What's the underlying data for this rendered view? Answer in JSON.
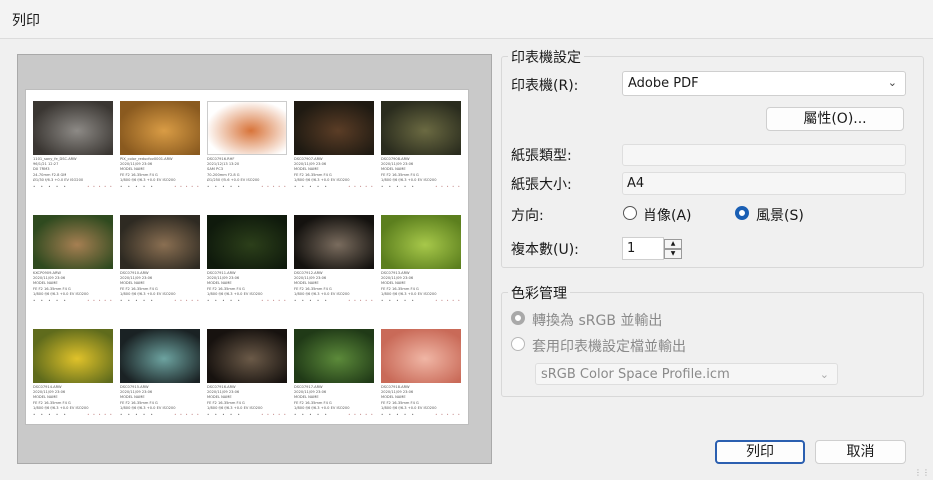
{
  "window": {
    "title": "列印"
  },
  "printer_settings": {
    "group_title": "印表機設定",
    "printer_label": "印表機(R):",
    "printer_value": "Adobe PDF",
    "properties_button": "屬性(O)...",
    "paper_type_label": "紙張類型:",
    "paper_type_value": "",
    "paper_size_label": "紙張大小:",
    "paper_size_value": "A4",
    "orientation_label": "方向:",
    "portrait_label": "肖像(A)",
    "landscape_label": "風景(S)",
    "orientation_selected": "landscape",
    "copies_label": "複本數(U):",
    "copies_value": "1"
  },
  "color_management": {
    "group_title": "色彩管理",
    "convert_srgb_label": "轉換為 sRGB 並輸出",
    "use_printer_profile_label": "套用印表機設定檔並輸出",
    "profile_value": "sRGB Color Space Profile.icm"
  },
  "buttons": {
    "print": "列印",
    "cancel": "取消"
  },
  "thumbnails": [
    {
      "c1": "#3a3632",
      "c2": "#8d8a86",
      "meta": [
        "1101_sony_fe_DSC.ARW",
        "96/1/21 12:27",
        "DX 7RM3",
        "24-70mm F2.8 GM",
        "Ø1/30 f/6.3 +0.0 EV ISO200"
      ]
    },
    {
      "c1": "#8a5a1f",
      "c2": "#d99c45",
      "meta": [
        "PIX_color_reducfov0001.ARW",
        "2020/11/09 23:06",
        "MODEL NAME",
        "FE F2 16-35mm F4 G",
        "1/800 f/6 f/6.3 +0.0 EV ISO200"
      ]
    },
    {
      "c1": "#ffffff",
      "c2": "#d8743a",
      "meta": [
        "DSC07916.RHF",
        "2021/12/13 13:20",
        "SAM PC3",
        "70-200mm F2.8 G",
        "Ø1/250 f/5.6 +0.0 EV ISO200"
      ]
    },
    {
      "c1": "#1f1a12",
      "c2": "#5b3d26",
      "meta": [
        "DSC07907.ARW",
        "2020/11/09 23:06",
        "MODEL NAME",
        "FE F2 16-35mm F4 G",
        "1/800 f/6 f/6.3 +0.0 EV ISO200"
      ]
    },
    {
      "c1": "#2a2c1e",
      "c2": "#6b6a42",
      "meta": [
        "DSC07908.ARW",
        "2020/11/09 23:06",
        "MODEL NAME",
        "FE F2 16-35mm F4 G",
        "1/800 f/6 f/6.3 +0.0 EV ISO200"
      ]
    },
    {
      "c1": "#2f4a1f",
      "c2": "#a67f52",
      "meta": [
        "KXCP0909.ARW",
        "2020/11/09 23:06",
        "MODEL NAME",
        "FE F2 16-35mm F4 G",
        "1/800 f/6 f/6.3 +0.0 EV ISO200"
      ]
    },
    {
      "c1": "#2e2a22",
      "c2": "#8a6f52",
      "meta": [
        "DSC07910.ARW",
        "2020/11/09 23:06",
        "MODEL NAME",
        "FE F2 16-35mm F4 G",
        "1/800 f/6 f/6.3 +0.0 EV ISO200"
      ]
    },
    {
      "c1": "#0f1a0c",
      "c2": "#2c3f1a",
      "meta": [
        "DSC07911.ARW",
        "2020/11/09 23:06",
        "MODEL NAME",
        "FE F2 16-35mm F4 G",
        "1/800 f/6 f/6.3 +0.0 EV ISO200"
      ]
    },
    {
      "c1": "#14120f",
      "c2": "#7a6c5e",
      "meta": [
        "DSC07912.ARW",
        "2020/11/09 23:06",
        "MODEL NAME",
        "FE F2 16-35mm F4 G",
        "1/800 f/6 f/6.3 +0.0 EV ISO200"
      ]
    },
    {
      "c1": "#5c7f1e",
      "c2": "#a7c84a",
      "meta": [
        "DSC07913.ARW",
        "2020/11/09 23:06",
        "MODEL NAME",
        "FE F2 16-35mm F4 G",
        "1/800 f/6 f/6.3 +0.0 EV ISO200"
      ]
    },
    {
      "c1": "#5f6b1c",
      "c2": "#e0c22a",
      "meta": [
        "DSC07914.ARW",
        "2020/11/09 23:06",
        "MODEL NAME",
        "FE F2 16-35mm F4 G",
        "1/800 f/6 f/6.3 +0.0 EV ISO200"
      ]
    },
    {
      "c1": "#1a2224",
      "c2": "#6da3a0",
      "meta": [
        "DSC07915.ARW",
        "2020/11/09 23:06",
        "MODEL NAME",
        "FE F2 16-35mm F4 G",
        "1/800 f/6 f/6.3 +0.0 EV ISO200"
      ]
    },
    {
      "c1": "#17120f",
      "c2": "#6b5a48",
      "meta": [
        "DSC07916.ARW",
        "2020/11/09 23:06",
        "MODEL NAME",
        "FE F2 16-35mm F4 G",
        "1/800 f/6 f/6.3 +0.0 EV ISO200"
      ]
    },
    {
      "c1": "#203a17",
      "c2": "#5c8a3a",
      "meta": [
        "DSC07917.ARW",
        "2020/11/09 23:06",
        "MODEL NAME",
        "FE F2 16-35mm F4 G",
        "1/800 f/6 f/6.3 +0.0 EV ISO200"
      ]
    },
    {
      "c1": "#c96a58",
      "c2": "#f0b6a5",
      "meta": [
        "DSC07918.ARW",
        "2020/11/09 23:06",
        "MODEL NAME",
        "FE F2 16-35mm F4 G",
        "1/800 f/6 f/6.3 +0.0 EV ISO200"
      ]
    }
  ]
}
